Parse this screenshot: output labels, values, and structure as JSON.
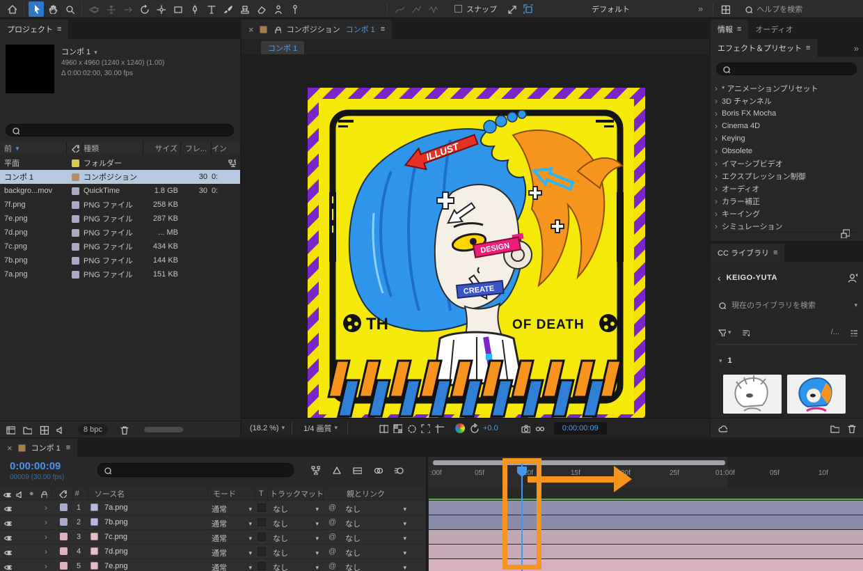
{
  "toolbar": {
    "snap_label": "スナップ",
    "workspace": "デフォルト",
    "overflow": "»",
    "help_search": "ヘルプを検索"
  },
  "project": {
    "tab": "プロジェクト",
    "menu_icon": "≡",
    "preview": {
      "name": "コンポ 1",
      "dims": "4960 x 4960 (1240 x 1240) (1.00)",
      "duration": "Δ 0:00:02:00, 30.00 fps"
    },
    "columns": {
      "name": "前",
      "type": "種類",
      "size": "サイズ",
      "frame": "フレ...",
      "in": "イン"
    },
    "rows": [
      {
        "name": "平面",
        "type": "フォルダー",
        "size": "",
        "frame": "",
        "in": ""
      },
      {
        "name": "コンポ 1",
        "type": "コンポジション",
        "size": "",
        "frame": "30",
        "in": "0:"
      },
      {
        "name": "backgro...mov",
        "type": "QuickTime",
        "size": "1.8 GB",
        "frame": "30",
        "in": "0:"
      },
      {
        "name": "7f.png",
        "type": "PNG ファイル",
        "size": "258 KB",
        "frame": "",
        "in": ""
      },
      {
        "name": "7e.png",
        "type": "PNG ファイル",
        "size": "287 KB",
        "frame": "",
        "in": ""
      },
      {
        "name": "7d.png",
        "type": "PNG ファイル",
        "size": "... MB",
        "frame": "",
        "in": ""
      },
      {
        "name": "7c.png",
        "type": "PNG ファイル",
        "size": "434 KB",
        "frame": "",
        "in": ""
      },
      {
        "name": "7b.png",
        "type": "PNG ファイル",
        "size": "144 KB",
        "frame": "",
        "in": ""
      },
      {
        "name": "7a.png",
        "type": "PNG ファイル",
        "size": "151 KB",
        "frame": "",
        "in": ""
      }
    ],
    "footer": {
      "bpc": "8 bpc"
    }
  },
  "comp": {
    "close": "×",
    "panel_title": "コンポジション",
    "comp_name": "コンポ 1",
    "menu_icon": "≡",
    "viewer_tab": "コンポ 1",
    "zoom": "(18.2 %)",
    "quality": "1/4 画質",
    "exposure": "+0.0",
    "timecode": "0:00:00:09",
    "artwork": {
      "left_text": "TH",
      "right_text": "OF DEATH",
      "sticker_illust": "ILLUST",
      "sticker_design": "DESIGN",
      "sticker_create": "CREATE"
    }
  },
  "right": {
    "tab_info": "情報",
    "tab_audio": "オーディオ",
    "effects": {
      "title": "エフェクト＆プリセット",
      "menu_icon": "≡",
      "overflow": "»",
      "items": [
        "* アニメーションプリセット",
        "3D チャンネル",
        "Boris FX Mocha",
        "Cinema 4D",
        "Keying",
        "Obsolete",
        "イマーシブビデオ",
        "エクスプレッション制御",
        "オーディオ",
        "カラー補正",
        "キーイング",
        "シミュレーション"
      ]
    },
    "libraries": {
      "title": "CC ライブラリ",
      "menu_icon": "≡",
      "back": "‹",
      "account": "KEIGO-YUTA",
      "search_placeholder": "現在のライブラリを検索",
      "group_label": "1"
    }
  },
  "timeline": {
    "close": "×",
    "tab": "コンポ 1",
    "menu_icon": "≡",
    "timecode": "0:00:00:09",
    "frame_info": "00009 (30.00 fps)",
    "ruler": [
      ":00f",
      "05f",
      "10f",
      "15f",
      "20f",
      "25f",
      "01:00f",
      "05f",
      "10f"
    ],
    "columns": {
      "num": "#",
      "source": "ソース名",
      "mode": "モード",
      "t": "T",
      "trkmat": "トラックマット",
      "parent": "親とリンク"
    },
    "rows": [
      {
        "num": "1",
        "name": "7a.png",
        "mode": "通常",
        "trkmat": "なし",
        "parent": "なし"
      },
      {
        "num": "2",
        "name": "7b.png",
        "mode": "通常",
        "trkmat": "なし",
        "parent": "なし"
      },
      {
        "num": "3",
        "name": "7c.png",
        "mode": "通常",
        "trkmat": "なし",
        "parent": "なし"
      },
      {
        "num": "4",
        "name": "7d.png",
        "mode": "通常",
        "trkmat": "なし",
        "parent": "なし"
      },
      {
        "num": "5",
        "name": "7e.png",
        "mode": "通常",
        "trkmat": "なし",
        "parent": "なし"
      }
    ]
  },
  "colors": {
    "accent_blue": "#3f9ef8",
    "annotation_orange": "#f7941d",
    "label_lavender": "#a9abce",
    "label_pink": "#e3b0c2",
    "label_yellow": "#dcc94f",
    "label_tan": "#b98d5f"
  }
}
